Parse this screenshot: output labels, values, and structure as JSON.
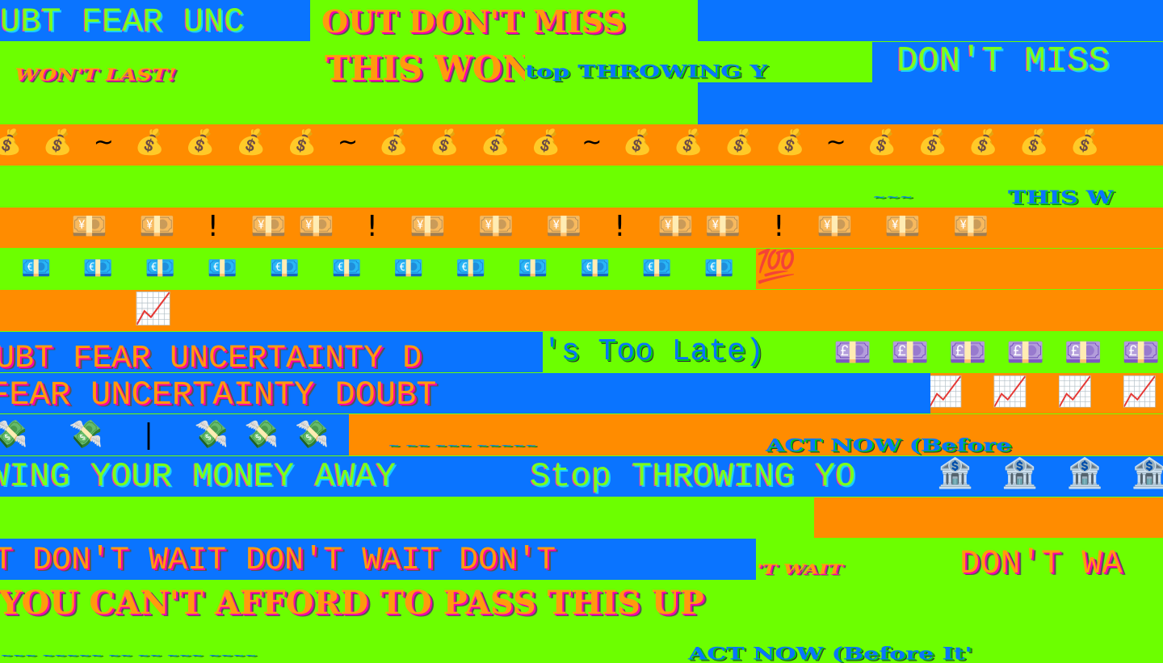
{
  "marquee": {
    "fud": "UBT  FEAR UNC",
    "dont_miss_out": "OUT   DON'T MISS",
    "wont_last": "WON'T LAST!",
    "this_won": "THIS WON",
    "stop_throwing_y": "top THROWING Y",
    "dont_miss": "DON'T MISS",
    "money_bags": "💰 💰 ~ 💰 💰 💰 💰 ~ 💰 💰 💰 💰 ~ 💰 💰 💰 💰 ~ 💰 💰 💰 💰 💰",
    "this_w": "THIS W",
    "faint_small": "~~~",
    "yen_row": "💴  💴  ! 💴💴  ! 💴  💴  💴  ! 💴💴  ! 💴  💴  💴",
    "euro_row": "💶 💶 💶 💶 💶 💶 💶 💶 💶 💶 💶 💶 💶 💶 💶 💶",
    "hundred": "💯",
    "chart": "📈",
    "fud_wide": "UBT  FEAR UNCERTAINTY D",
    "too_late": "'s Too Late)",
    "pound_row": "💷 💷 💷 💷 💷 💷 💷 💷",
    "fud_full": " FEAR UNCERTAINTY DOUBT",
    "chart_row": "📈 📈 📈 📈 📈",
    "flying_money": "💸  💸  | 💸💸💸  💸  💸",
    "act_now_faint": "~ ~~ ~~~ ~~~~~",
    "act_now": "ACT NOW (Before",
    "throwing_money": "WING YOUR MONEY AWAY",
    "stop_throwing": "Stop THROWING YO",
    "bank_row": "🏦 🏦 🏦 🏦 🏦",
    "dont_wait_row": "T  DON'T WAIT   DON'T WAIT    DON'T",
    "dont_wait_small": "'T WAIT",
    "dont_wa": "DON'T WA",
    "afford": "YOU CAN'T AFFORD TO PASS THIS UP",
    "bottom_faint": "~~~ ~~~~~ ~~ ~~ ~~~ ~~~~",
    "bottom_act_now": "ACT NOW (Before It'"
  },
  "colors": {
    "green": "#6cff00",
    "blue": "#0a74ff",
    "orange": "#ff8c00"
  }
}
